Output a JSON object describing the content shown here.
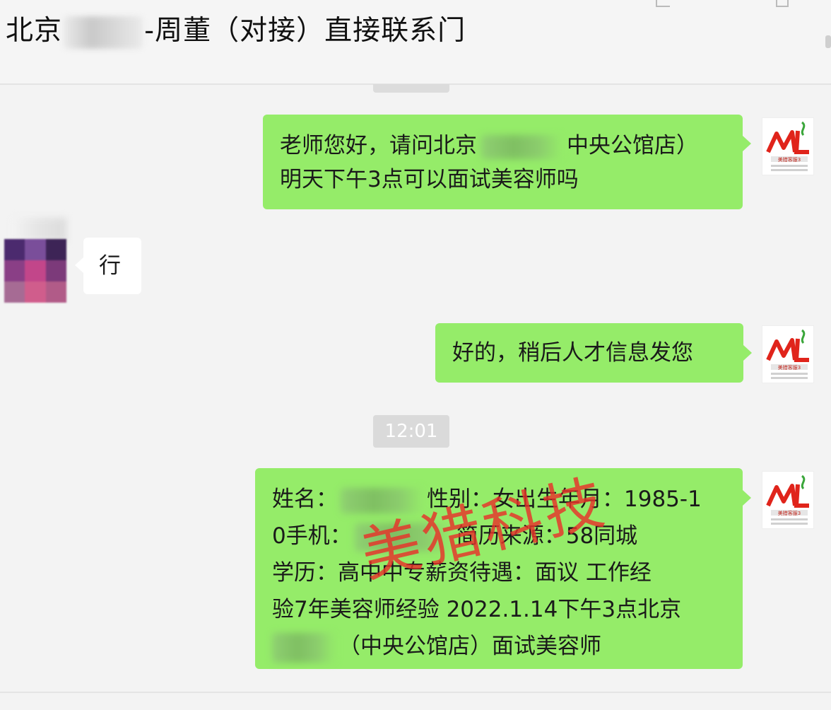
{
  "header": {
    "title_prefix": "北京",
    "title_suffix": "-周董（对接）直接联系门"
  },
  "messages": [
    {
      "side": "right",
      "line1_a": "老师您好，请问北京",
      "line1_b": "中央公馆店）",
      "line2": "明天下午3点可以面试美容师吗"
    },
    {
      "side": "left",
      "text": "行"
    },
    {
      "side": "right",
      "text": "好的，稍后人才信息发您"
    },
    {
      "side": "right",
      "line1_a": "姓名：",
      "line1_b": "性别：女出生年月：1985-1",
      "line2_a": "0手机：",
      "line2_b": "简历来源：58同城",
      "line3": "学历：高中中专薪资待遇：面议 工作经",
      "line4": "验7年美容师经验 2022.1.14下午3点北京",
      "line5": "（中央公馆店）面试美容师"
    }
  ],
  "timestamp": "12:01",
  "watermark": "美猎科技",
  "avatar_right": {
    "logo_text": "ML",
    "caption": "美猎客服3",
    "icon": "meilie-logo-icon",
    "brand_color": "#e0241b",
    "accent_color": "#3aa63a"
  },
  "colors": {
    "sent_bubble": "#95ec69",
    "received_bubble": "#ffffff",
    "background": "#f3f3f3"
  }
}
